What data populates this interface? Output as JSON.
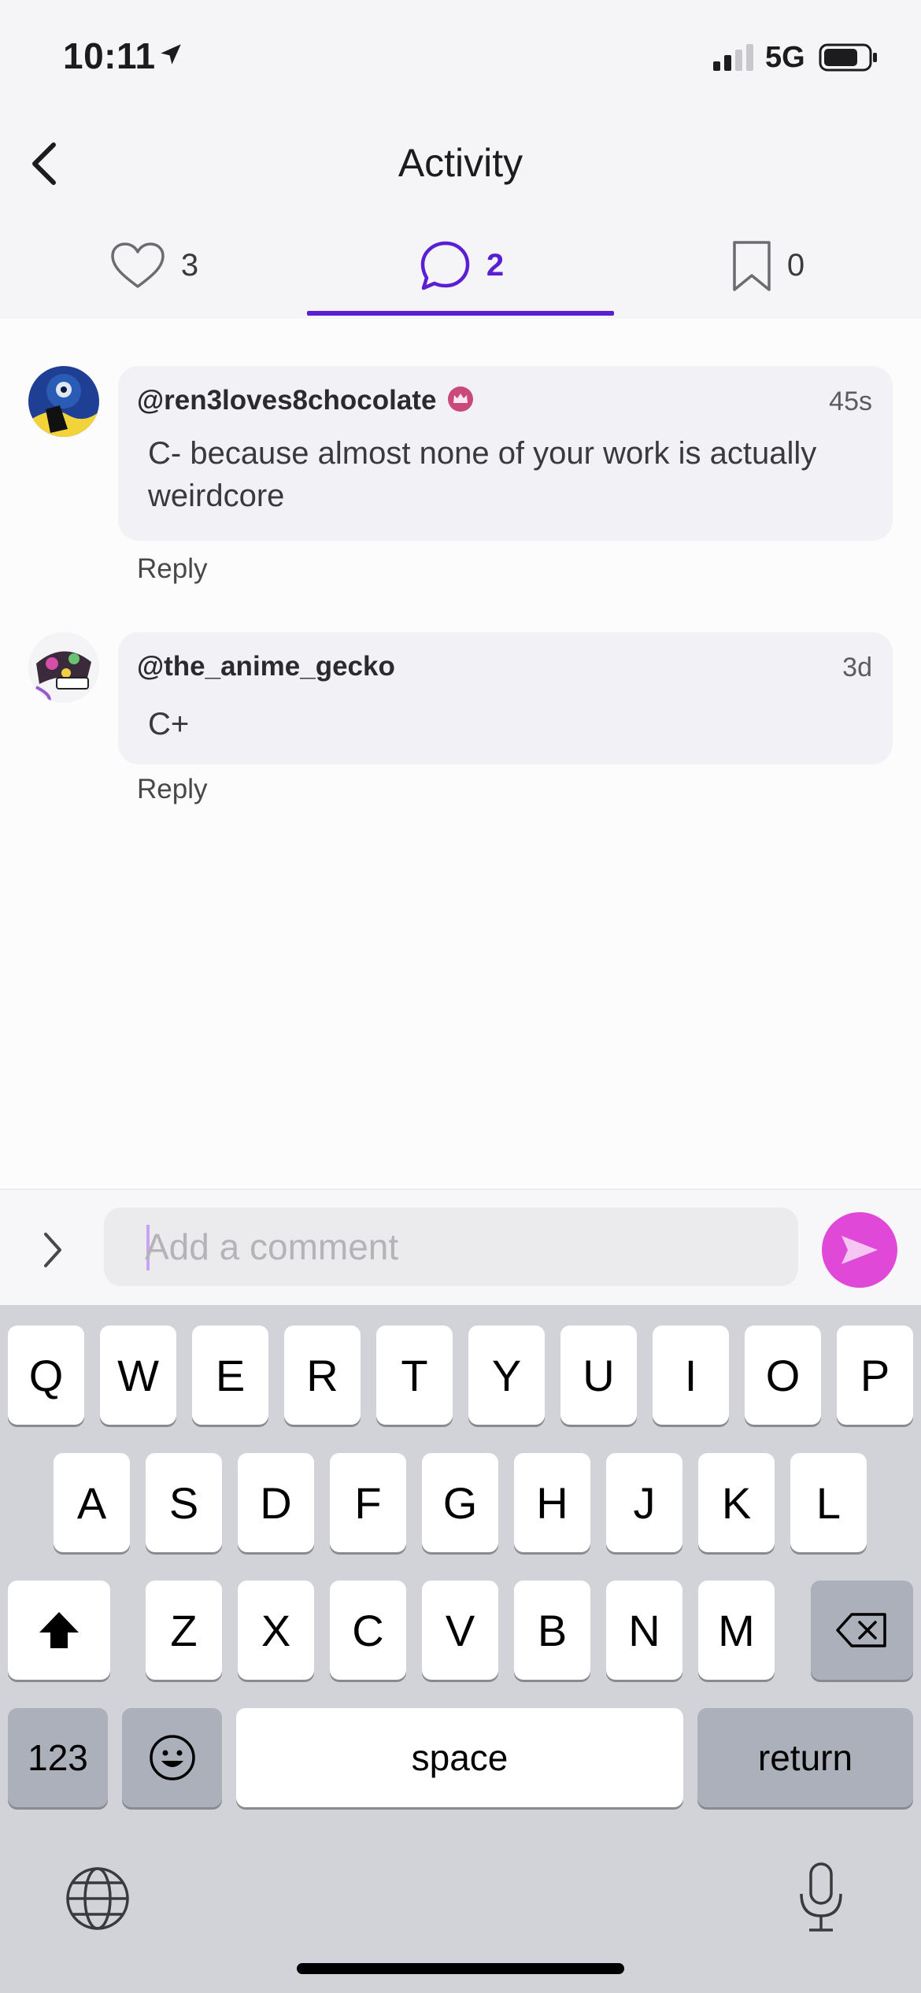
{
  "status_bar": {
    "time": "10:11",
    "network": "5G"
  },
  "header": {
    "title": "Activity"
  },
  "tabs": [
    {
      "name": "likes",
      "icon": "heart-icon",
      "count": "3",
      "active": false
    },
    {
      "name": "comments",
      "icon": "chat-bubble-icon",
      "count": "2",
      "active": true
    },
    {
      "name": "saves",
      "icon": "bookmark-icon",
      "count": "0",
      "active": false
    }
  ],
  "comments": [
    {
      "username": "@ren3loves8chocolate",
      "time": "45s",
      "text": "C- because almost none of your work is actually weirdcore",
      "reply_label": "Reply",
      "badge": "crown-badge-icon"
    },
    {
      "username": "@the_anime_gecko",
      "time": "3d",
      "text": "C+",
      "reply_label": "Reply"
    }
  ],
  "input": {
    "placeholder": "Add a comment",
    "value": ""
  },
  "colors": {
    "accent": "#5a1fd3",
    "send": "#e048d8",
    "badge": "#c94a7a"
  },
  "keyboard": {
    "row1": [
      "Q",
      "W",
      "E",
      "R",
      "T",
      "Y",
      "U",
      "I",
      "O",
      "P"
    ],
    "row2": [
      "A",
      "S",
      "D",
      "F",
      "G",
      "H",
      "J",
      "K",
      "L"
    ],
    "row3": [
      "Z",
      "X",
      "C",
      "V",
      "B",
      "N",
      "M"
    ],
    "numbers_label": "123",
    "space_label": "space",
    "return_label": "return"
  }
}
